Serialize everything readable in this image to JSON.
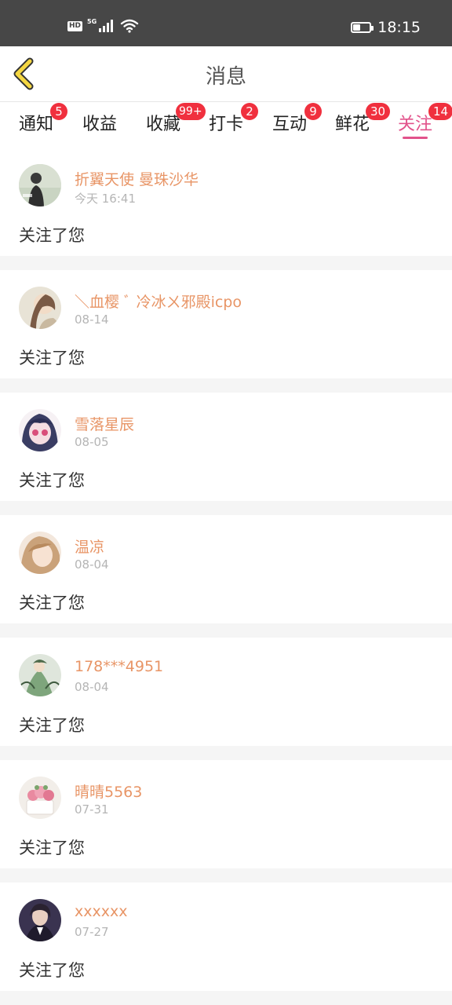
{
  "status_bar": {
    "hd": "HD",
    "network": "5G",
    "time": "18:15",
    "battery_level": 0.45
  },
  "header": {
    "title": "消息"
  },
  "tabs": [
    {
      "label": "通知",
      "badge": "5",
      "active": false
    },
    {
      "label": "收益",
      "badge": "",
      "active": false
    },
    {
      "label": "收藏",
      "badge": "99+",
      "active": false
    },
    {
      "label": "打卡",
      "badge": "2",
      "active": false
    },
    {
      "label": "互动",
      "badge": "9",
      "active": false
    },
    {
      "label": "鲜花",
      "badge": "30",
      "active": false
    },
    {
      "label": "关注",
      "badge": "14",
      "active": true
    }
  ],
  "messages": [
    {
      "name": "折翼天使 曼珠沙华",
      "time": "今天 16:41",
      "text": "关注了您"
    },
    {
      "name": "＼血樱 ﾞ 冷冰ㄨ邪殿icpo",
      "time": "08-14",
      "text": "关注了您"
    },
    {
      "name": "雪落星辰",
      "time": "08-05",
      "text": "关注了您"
    },
    {
      "name": "温凉",
      "time": "08-04",
      "text": "关注了您"
    },
    {
      "name": "178***4951",
      "time": "08-04",
      "text": "关注了您"
    },
    {
      "name": "晴晴5563",
      "time": "07-31",
      "text": "关注了您"
    },
    {
      "name": "xxxxxx",
      "time": "07-27",
      "text": "关注了您"
    }
  ],
  "colors": {
    "accent": "#e2538b",
    "username": "#e89566",
    "badge": "#f0303e",
    "back_arrow": "#f5d742"
  }
}
